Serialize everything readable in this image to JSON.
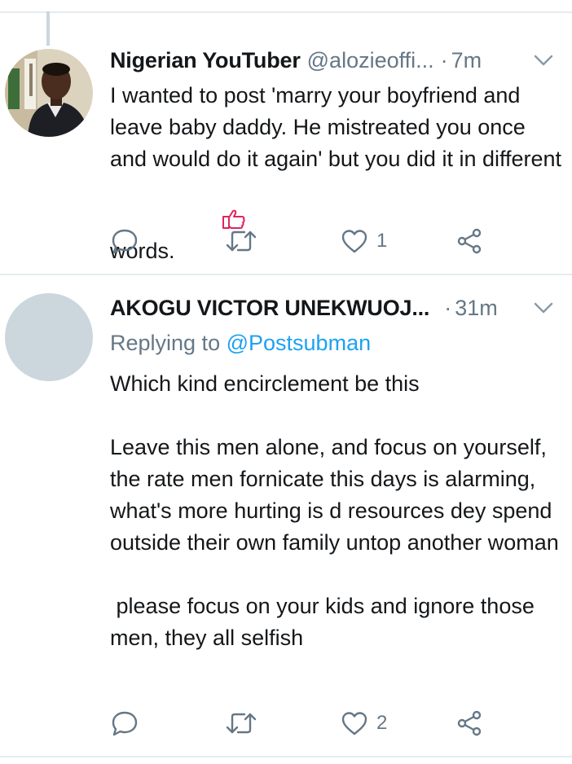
{
  "tweets": [
    {
      "author": "Nigerian YouTuber",
      "handle": "@alozieoffi...",
      "time": "7m",
      "text": "I wanted to post 'marry your boyfriend and leave baby daddy. He mistreated you once and would do it again' but you did it in different words.",
      "emoji": "thumbs-up-icon",
      "actions": {
        "reply_count": "",
        "retweet_count": "",
        "like_count": "1"
      }
    },
    {
      "author": "AKOGU VICTOR UNEKWUOJ...",
      "time": "31m",
      "replying_label": "Replying to",
      "replying_to": "@Postsubman",
      "paragraphs": [
        "Which kind encirclement be this",
        "Leave this men alone, and focus on yourself, the rate men fornicate this days is alarming, what's more hurting is d resources dey spend outside their own family untop another woman",
        " please focus on your kids and ignore those men, they all selfish"
      ],
      "actions": {
        "reply_count": "",
        "retweet_count": "",
        "like_count": "2"
      }
    }
  ],
  "colors": {
    "text": "#14171a",
    "secondary": "#657786",
    "link": "#1da1f2",
    "divider": "#e6ecf0",
    "avatar_placeholder": "#ccd6dd",
    "emoji": "#e0245e"
  }
}
